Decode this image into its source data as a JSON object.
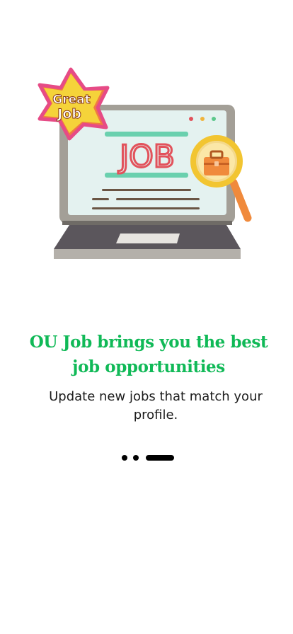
{
  "illustration": {
    "sticker_text_line1": "Great",
    "sticker_text_line2": "Job",
    "screen_text": "JOB"
  },
  "onboarding": {
    "title": "OU Job brings you the best job opportunities",
    "subtitle": "Update new jobs that match your profile."
  },
  "pager": {
    "total_pages": 3,
    "active_page": 3
  },
  "colors": {
    "title_green": "#10b957",
    "pager_dot": "#000000",
    "job_red": "#e2525b",
    "magnifier_orange": "#f08a3c"
  }
}
